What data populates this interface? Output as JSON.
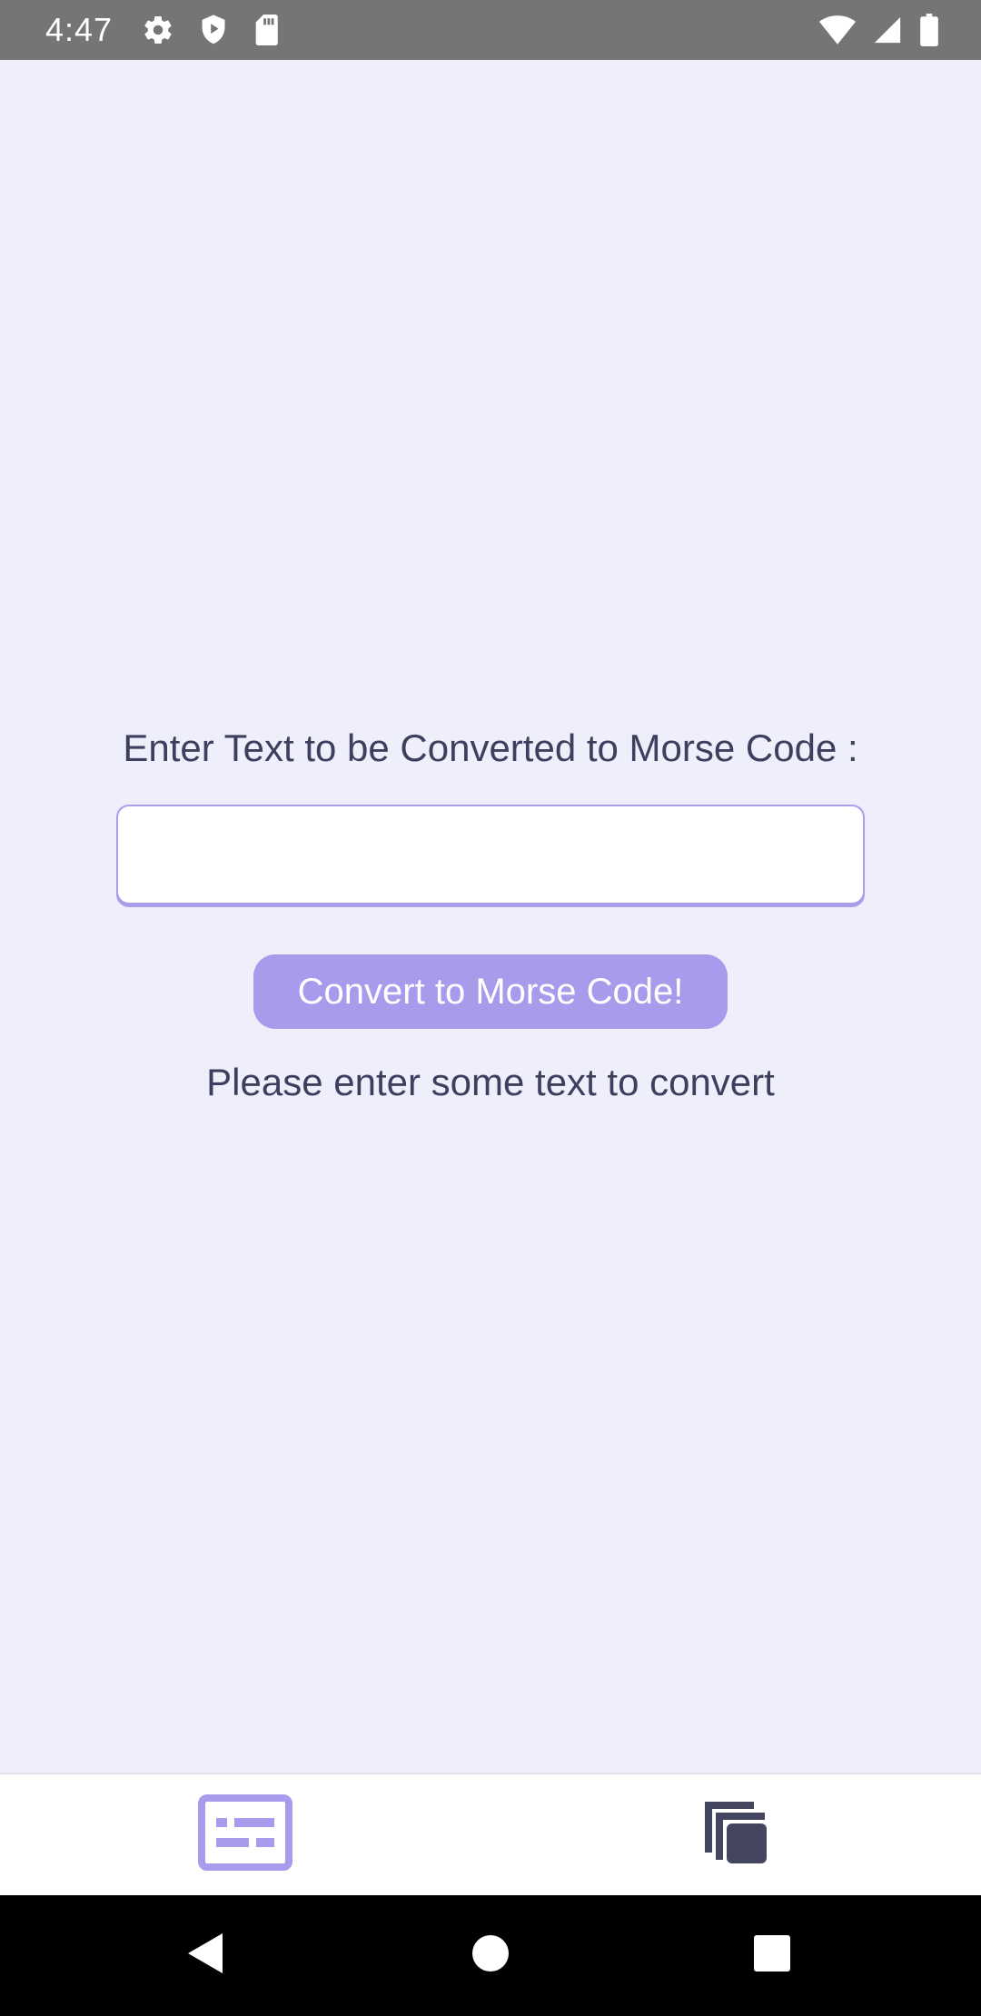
{
  "status_bar": {
    "time": "4:47",
    "left_icons": [
      "gear-icon",
      "shield-icon",
      "sd-card-icon"
    ],
    "right_icons": [
      "wifi-icon",
      "cell-signal-icon",
      "battery-icon"
    ]
  },
  "converter": {
    "prompt_label": "Enter Text to be Converted to Morse Code :",
    "input_value": "",
    "input_placeholder": "",
    "convert_button_label": "Convert to Morse Code!",
    "result_text": "Please enter some text to convert"
  },
  "tab_bar": {
    "tabs": [
      {
        "icon": "morse-text-icon",
        "active": true
      },
      {
        "icon": "copy-icon",
        "active": false
      }
    ]
  },
  "nav_bar": {
    "buttons": [
      "back-icon",
      "home-icon",
      "recents-icon"
    ]
  },
  "colors": {
    "background": "#EFEEFB",
    "accent": "#A99BEC",
    "text": "#3E3F5E",
    "status_bar": "#757575",
    "tab_inactive": "#44465F"
  }
}
